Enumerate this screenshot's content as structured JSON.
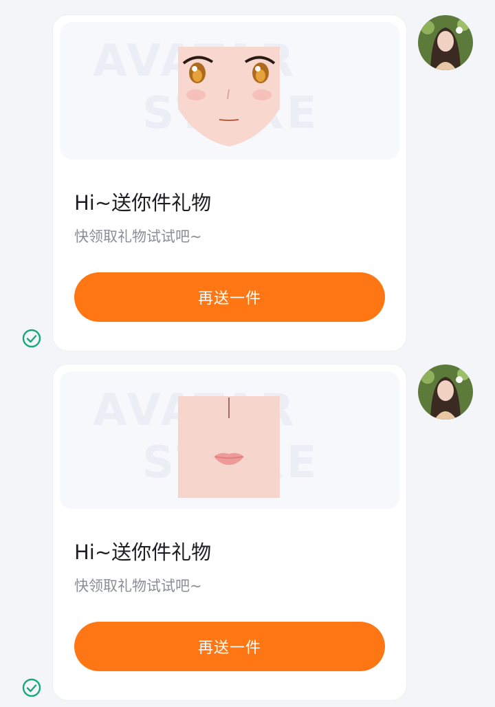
{
  "messages": [
    {
      "title": "Hi~送你件礼物",
      "subtitle": "快领取礼物试试吧~",
      "button_label": "再送一件",
      "watermark_line1": "AVATAR",
      "watermark_line2": "STORE",
      "gift_item": "eyes"
    },
    {
      "title": "Hi~送你件礼物",
      "subtitle": "快领取礼物试试吧~",
      "button_label": "再送一件",
      "watermark_line1": "AVATAR",
      "watermark_line2": "STORE",
      "gift_item": "lips"
    }
  ],
  "colors": {
    "accent": "#ff7714",
    "check": "#15a97a",
    "background": "#f4f5f8"
  },
  "icons": {
    "sent_status": "check-circle-icon"
  }
}
